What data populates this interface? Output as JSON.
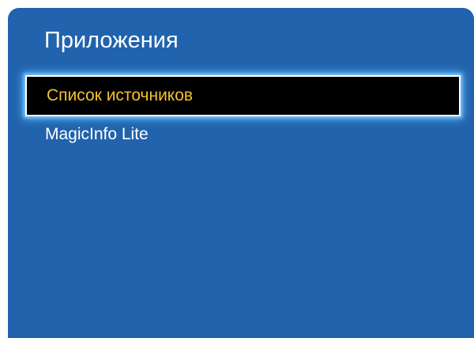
{
  "menu": {
    "title": "Приложения",
    "items": [
      {
        "label": "Список источников",
        "selected": true
      },
      {
        "label": "MagicInfo Lite",
        "selected": false
      }
    ]
  },
  "colors": {
    "panel_background": "#2163ad",
    "text": "#ffffff",
    "selected_text": "#f6c12a",
    "selected_background": "#000000",
    "focus_glow": "#7cc7ff"
  }
}
